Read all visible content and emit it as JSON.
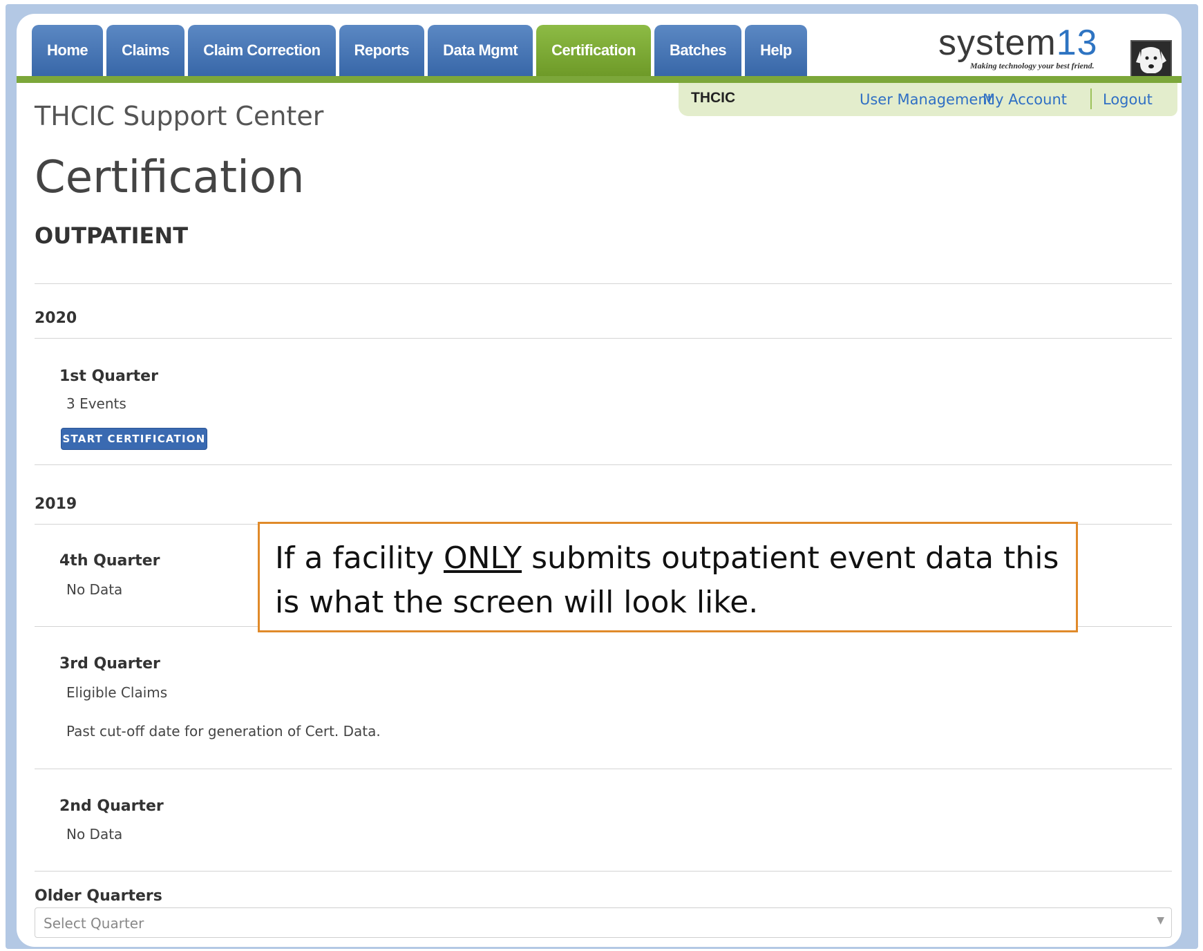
{
  "nav": {
    "tabs": [
      {
        "label": "Home"
      },
      {
        "label": "Claims"
      },
      {
        "label": "Claim Correction"
      },
      {
        "label": "Reports"
      },
      {
        "label": "Data Mgmt"
      },
      {
        "label": "Certification",
        "active": true
      },
      {
        "label": "Batches"
      },
      {
        "label": "Help"
      }
    ],
    "active_color": "#7ca73a",
    "tab_color": "#3f6fae"
  },
  "logo": {
    "word": "system",
    "number": "13",
    "tagline": "Making technology your best friend.",
    "icon": "dog-icon"
  },
  "subbar": {
    "org": "THCIC",
    "user_management": "User Management",
    "my_account": "My Account",
    "logout": "Logout"
  },
  "site_title": "THCIC Support Center",
  "page_title": "Certification",
  "section_title": "OUTPATIENT",
  "years": [
    {
      "year": "2020",
      "quarters": [
        {
          "name": "1st Quarter",
          "detail": "3 Events",
          "button": "START CERTIFICATION"
        }
      ]
    },
    {
      "year": "2019",
      "quarters": [
        {
          "name": "4th Quarter",
          "detail": "No Data"
        },
        {
          "name": "3rd Quarter",
          "detail": "Eligible Claims",
          "note": "Past cut-off date for generation of Cert. Data."
        },
        {
          "name": "2nd Quarter",
          "detail": "No Data"
        }
      ]
    }
  ],
  "older": {
    "label": "Older Quarters",
    "placeholder": "Select Quarter"
  },
  "callout": {
    "before": "If a facility ",
    "emphasis": "ONLY",
    "after": " submits outpatient event data this is what the screen will look like.",
    "border_color": "#e08a2a"
  }
}
